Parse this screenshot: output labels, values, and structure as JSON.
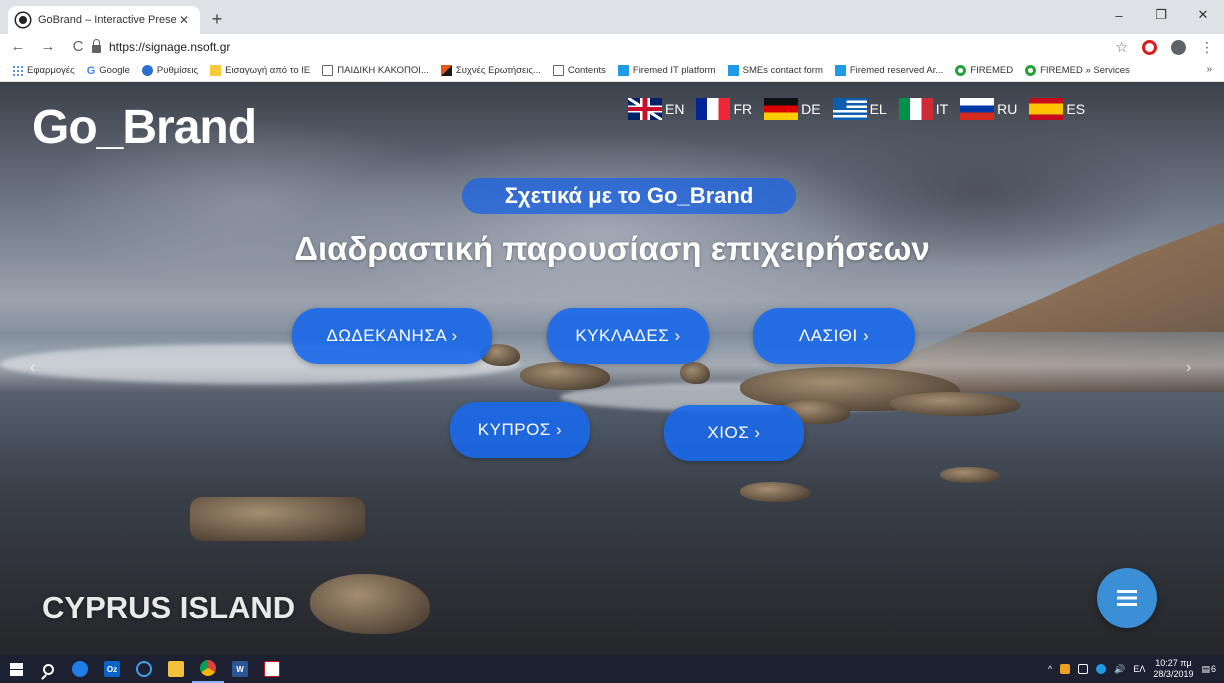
{
  "browser": {
    "tab_title": "GoBrand – Interactive Presentatio",
    "tab_close": "✕",
    "new_tab": "+",
    "url": "https://signage.nsoft.gr",
    "window": {
      "minimize": "–",
      "maximize": "❐",
      "close": "✕"
    },
    "nav": {
      "back": "←",
      "forward": "→",
      "reload": "C"
    },
    "star": "☆",
    "menu": "⋮",
    "bookmarks": [
      {
        "label": "Εφαρμογές",
        "icon": "apps-icon"
      },
      {
        "label": "Google",
        "icon": "google-icon"
      },
      {
        "label": "Ρυθμίσεις",
        "icon": "settings-icon"
      },
      {
        "label": "Εισαγωγή από το IE",
        "icon": "folder-icon"
      },
      {
        "label": "ΠΑΙΔΙΚΗ ΚΑΚΟΠΟΙ...",
        "icon": "page-icon"
      },
      {
        "label": "Συχνές Ερωτήσεις...",
        "icon": "flag-icon"
      },
      {
        "label": "Contents",
        "icon": "page-icon"
      },
      {
        "label": "Firemed IT platform",
        "icon": "blue-square-icon"
      },
      {
        "label": "SMEs contact form",
        "icon": "blue-square-icon"
      },
      {
        "label": "Firemed reserved Ar...",
        "icon": "blue-square-icon"
      },
      {
        "label": "FIREMED",
        "icon": "green-circle-icon"
      },
      {
        "label": "FIREMED » Services",
        "icon": "green-circle-icon"
      }
    ],
    "bookmarks_more": "»"
  },
  "page": {
    "logo": "Go_Brand",
    "languages": [
      {
        "code": "EN",
        "flag": "uk-flag-icon"
      },
      {
        "code": "FR",
        "flag": "france-flag-icon"
      },
      {
        "code": "DE",
        "flag": "germany-flag-icon"
      },
      {
        "code": "EL",
        "flag": "greece-flag-icon"
      },
      {
        "code": "IT",
        "flag": "italy-flag-icon"
      },
      {
        "code": "RU",
        "flag": "russia-flag-icon"
      },
      {
        "code": "ES",
        "flag": "spain-flag-icon"
      }
    ],
    "about_label": "Σχετικά με το Go_Brand",
    "headline": "Διαδραστική παρουσίαση επιχειρήσεων",
    "regions": [
      {
        "label": "ΔΩΔΕΚΑΝΗΣΑ ›"
      },
      {
        "label": "ΚΥΚΛΑΔΕΣ ›"
      },
      {
        "label": "ΛΑΣΙΘΙ ›"
      },
      {
        "label": "ΚΥΠΡΟΣ ›"
      },
      {
        "label": "ΧΙΟΣ ›"
      }
    ],
    "slider": {
      "prev": "‹",
      "next": "›"
    },
    "caption": "CYPRUS ISLAND",
    "menu_icon": "hamburger-icon"
  },
  "taskbar": {
    "apps": [
      "start-icon",
      "search-icon",
      "edge-icon",
      "outlook-icon",
      "ie-icon",
      "explorer-icon",
      "chrome-icon",
      "word-icon",
      "acrobat-icon"
    ],
    "outlook_label": "Oz",
    "word_label": "W",
    "tray_chevron": "^",
    "volume": "🔊",
    "language": "ΕΛ",
    "time": "10:27 πμ",
    "date": "28/3/2019",
    "notifications_count": "6"
  },
  "colors": {
    "button_blue": "#1868ea",
    "fab_blue": "#3b8fd6",
    "taskbar": "#1c2030"
  }
}
